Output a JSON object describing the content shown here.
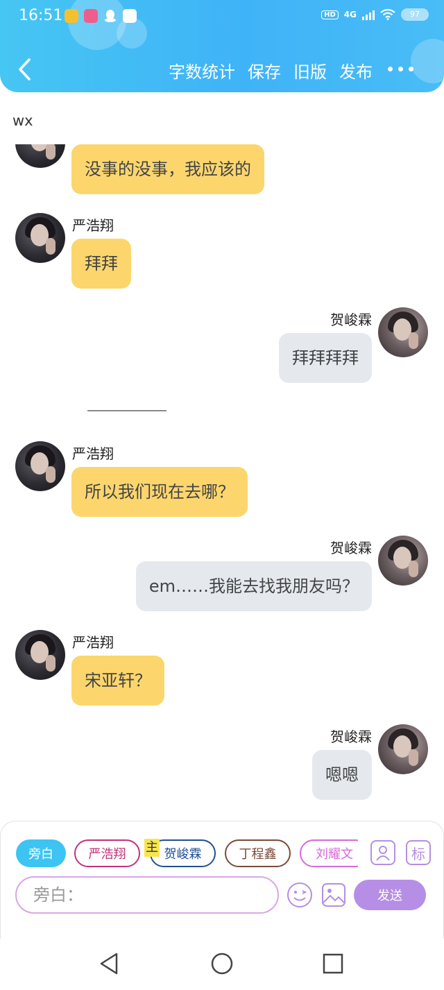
{
  "status_bar": {
    "time": "16:51",
    "network": "4G",
    "hd": "HD",
    "battery": "97"
  },
  "header": {
    "actions": [
      "字数统计",
      "保存",
      "旧版",
      "发布"
    ]
  },
  "story": {
    "title": "wx"
  },
  "messages": [
    {
      "side": "left",
      "name": "",
      "text": "没事的没事，我应该的"
    },
    {
      "side": "left",
      "name": "严浩翔",
      "text": "拜拜"
    },
    {
      "side": "right",
      "name": "贺峻霖",
      "text": "拜拜拜拜"
    },
    {
      "side": "left",
      "name": "严浩翔",
      "text": "所以我们现在去哪？"
    },
    {
      "side": "right",
      "name": "贺峻霖",
      "text": "em……我能去找我朋友吗？"
    },
    {
      "side": "left",
      "name": "严浩翔",
      "text": "宋亚轩？"
    },
    {
      "side": "right",
      "name": "贺峻霖",
      "text": "嗯嗯"
    }
  ],
  "composer": {
    "roles": [
      "旁白",
      "严浩翔",
      "贺峻霖",
      "丁程鑫",
      "刘耀文"
    ],
    "main_tag": "主",
    "mark_label": "标",
    "input_placeholder": "旁白：",
    "send_label": "发送"
  },
  "colors": {
    "header_blue": "#3fb3f7",
    "left_bubble": "#fcd66d",
    "right_bubble": "#e5e9ee",
    "accent_purple": "#b68ee6"
  }
}
